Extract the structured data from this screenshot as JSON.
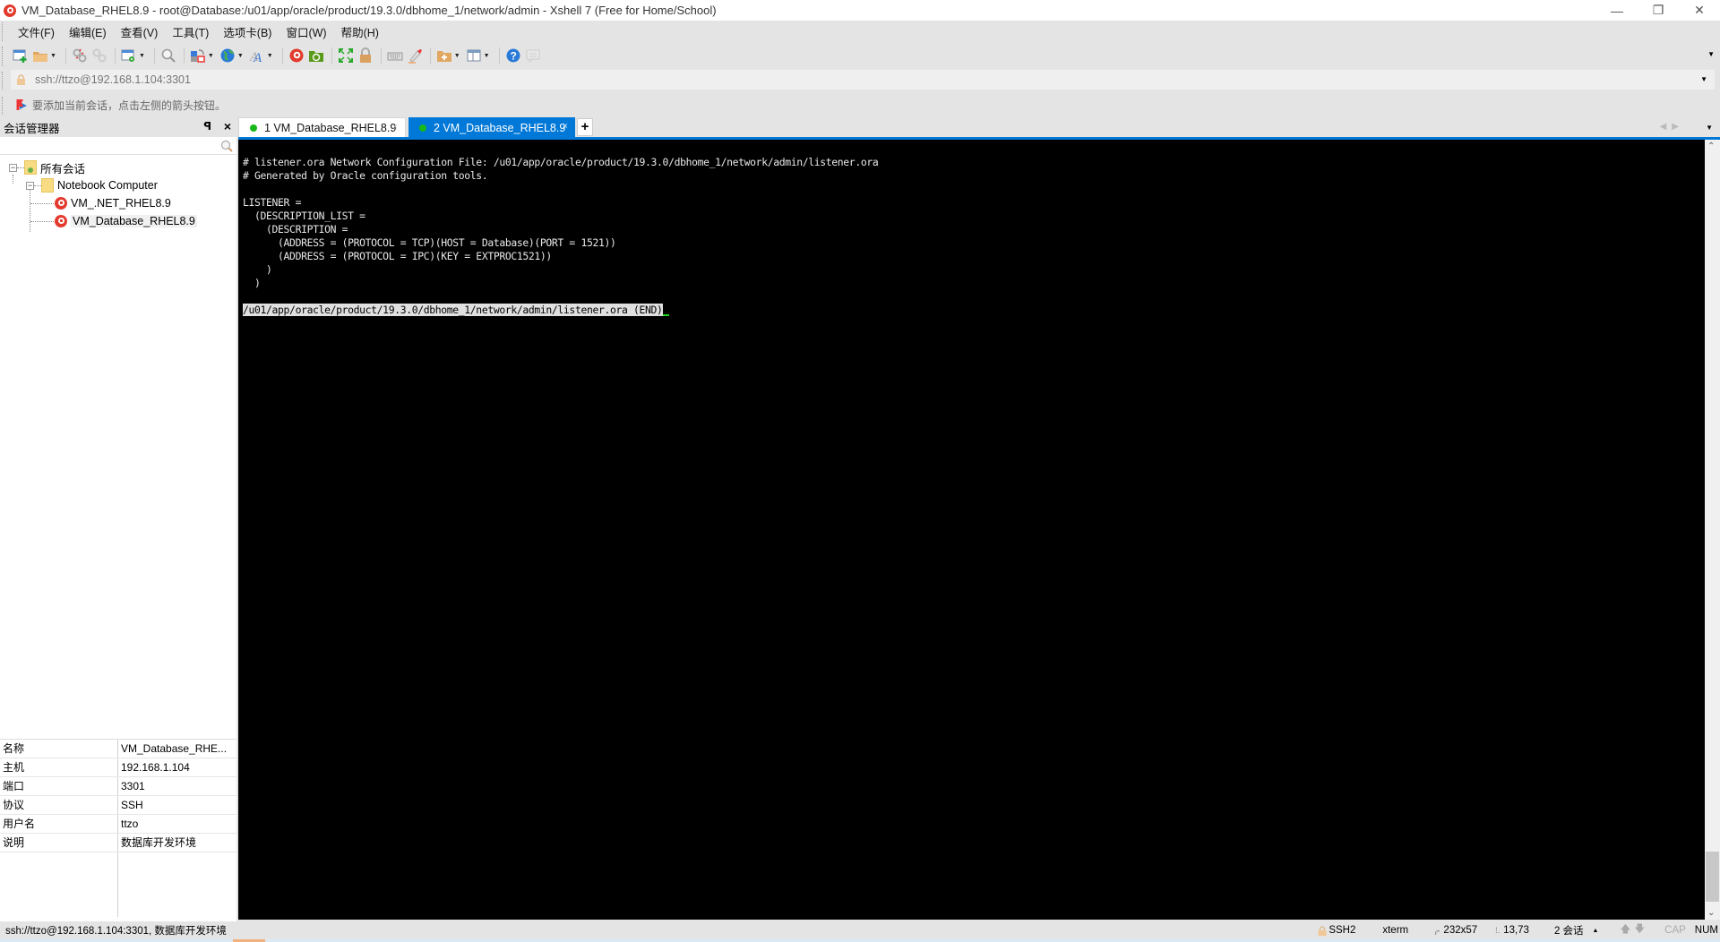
{
  "window": {
    "title": "VM_Database_RHEL8.9 - root@Database:/u01/app/oracle/product/19.3.0/dbhome_1/network/admin - Xshell 7 (Free for Home/School)",
    "controls": {
      "minimize": "—",
      "restore": "❐",
      "close": "✕"
    }
  },
  "menu": {
    "items": [
      "文件(F)",
      "编辑(E)",
      "查看(V)",
      "工具(T)",
      "选项卡(B)",
      "窗口(W)",
      "帮助(H)"
    ]
  },
  "toolbar": {
    "icons": [
      "new-session-icon",
      "open-folder-icon",
      "disconnect-icon",
      "reconnect-icon",
      "properties-icon",
      "find-icon",
      "transfer-icon",
      "globe-icon",
      "font-icon",
      "xshell-icon",
      "xftp-icon",
      "fullscreen-icon",
      "lock-icon",
      "keyboard-icon",
      "highlighter-icon",
      "new-folder-icon",
      "layout-icon",
      "help-icon",
      "chat-icon"
    ]
  },
  "address": {
    "value": "ssh://ttzo@192.168.1.104:3301"
  },
  "hint": {
    "text": "要添加当前会话，点击左侧的箭头按钮。"
  },
  "session_manager": {
    "title": "会话管理器",
    "search_placeholder": "",
    "tree": [
      {
        "label": "所有会话",
        "type": "root-folder"
      },
      {
        "label": "Notebook Computer",
        "type": "folder"
      },
      {
        "label": "VM_.NET_RHEL8.9",
        "type": "session"
      },
      {
        "label": "VM_Database_RHEL8.9",
        "type": "session",
        "selected": true
      }
    ],
    "properties": [
      {
        "key": "名称",
        "value": "VM_Database_RHE..."
      },
      {
        "key": "主机",
        "value": "192.168.1.104"
      },
      {
        "key": "端口",
        "value": "3301"
      },
      {
        "key": "协议",
        "value": "SSH"
      },
      {
        "key": "用户名",
        "value": "ttzo"
      },
      {
        "key": "说明",
        "value": "数据库开发环境"
      }
    ]
  },
  "tabs": [
    {
      "label": "1 VM_Database_RHEL8.9",
      "active": false,
      "status": "connected"
    },
    {
      "label": "2 VM_Database_RHEL8.9",
      "active": true,
      "status": "connected"
    }
  ],
  "tab_add_label": "+",
  "terminal": {
    "lines": [
      "# listener.ora Network Configuration File: /u01/app/oracle/product/19.3.0/dbhome_1/network/admin/listener.ora",
      "# Generated by Oracle configuration tools.",
      "",
      "LISTENER =",
      "  (DESCRIPTION_LIST =",
      "    (DESCRIPTION =",
      "      (ADDRESS = (PROTOCOL = TCP)(HOST = Database)(PORT = 1521))",
      "      (ADDRESS = (PROTOCOL = IPC)(KEY = EXTPROC1521))",
      "    )",
      "  )",
      ""
    ],
    "pager_status": "/u01/app/oracle/product/19.3.0/dbhome_1/network/admin/listener.ora (END)"
  },
  "statusbar": {
    "connection": "ssh://ttzo@192.168.1.104:3301, 数据库开发环境",
    "protocol": "SSH2",
    "terminal_type": "xterm",
    "size": "232x57",
    "cursor_pos": "13,73",
    "sessions": "2 会话",
    "cap": "CAP",
    "num": "NUM"
  }
}
